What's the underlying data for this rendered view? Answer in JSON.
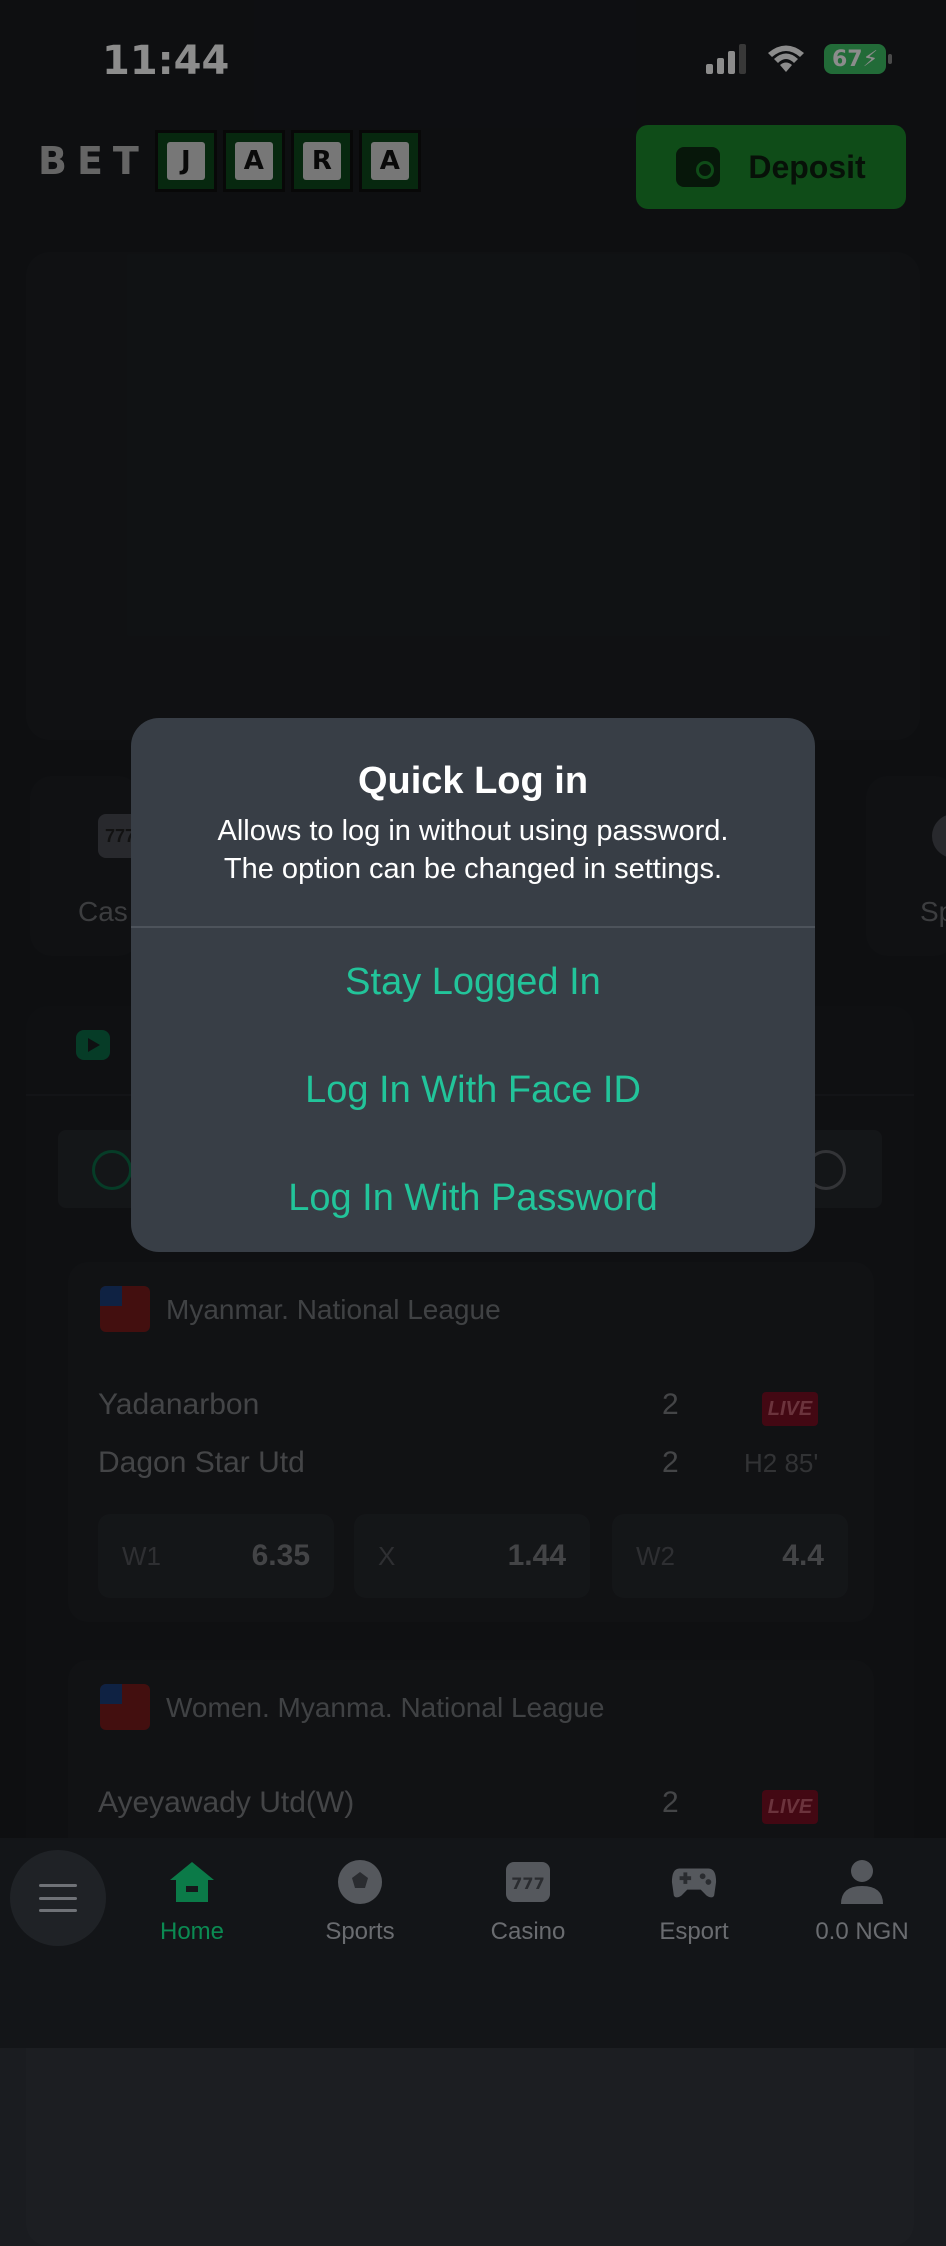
{
  "status_bar": {
    "time": "11:44",
    "battery": "67"
  },
  "header": {
    "logo_bet": "BET",
    "logo_tiles": [
      "J",
      "A",
      "R",
      "A"
    ],
    "deposit_label": "Deposit"
  },
  "categories": [
    {
      "label": "Cas",
      "icon": "casino-icon"
    },
    {
      "label": "Sp",
      "icon": "sports-icon"
    }
  ],
  "matches": [
    {
      "league": "Myanmar. National League",
      "home": "Yadanarbon",
      "home_score": "2",
      "away": "Dagon Star Utd",
      "away_score": "2",
      "live": "LIVE",
      "period": "H2 85'",
      "odds": [
        {
          "label": "W1",
          "value": "6.35"
        },
        {
          "label": "X",
          "value": "1.44"
        },
        {
          "label": "W2",
          "value": "4.4"
        }
      ]
    },
    {
      "league": "Women. Myanma. National League",
      "home": "Ayeyawady Utd(W)",
      "home_score": "2",
      "live": "LIVE"
    }
  ],
  "dialog": {
    "title": "Quick Log in",
    "message_line1": "Allows to log in without using password.",
    "message_line2": "The option can be changed in settings.",
    "actions": [
      "Stay Logged In",
      "Log In With Face ID",
      "Log In With Password"
    ]
  },
  "bottom_nav": [
    {
      "label": "Home",
      "icon": "home-icon",
      "active": true
    },
    {
      "label": "Sports",
      "icon": "soccer-ball-icon"
    },
    {
      "label": "Casino",
      "icon": "slot-777-icon"
    },
    {
      "label": "Esport",
      "icon": "gamepad-icon"
    },
    {
      "label": "0.0 NGN",
      "icon": "user-icon"
    }
  ],
  "colors": {
    "accent": "#22c49a",
    "deposit": "#1c8a2c",
    "live": "#7a0f24",
    "background": "#1a1c20"
  }
}
